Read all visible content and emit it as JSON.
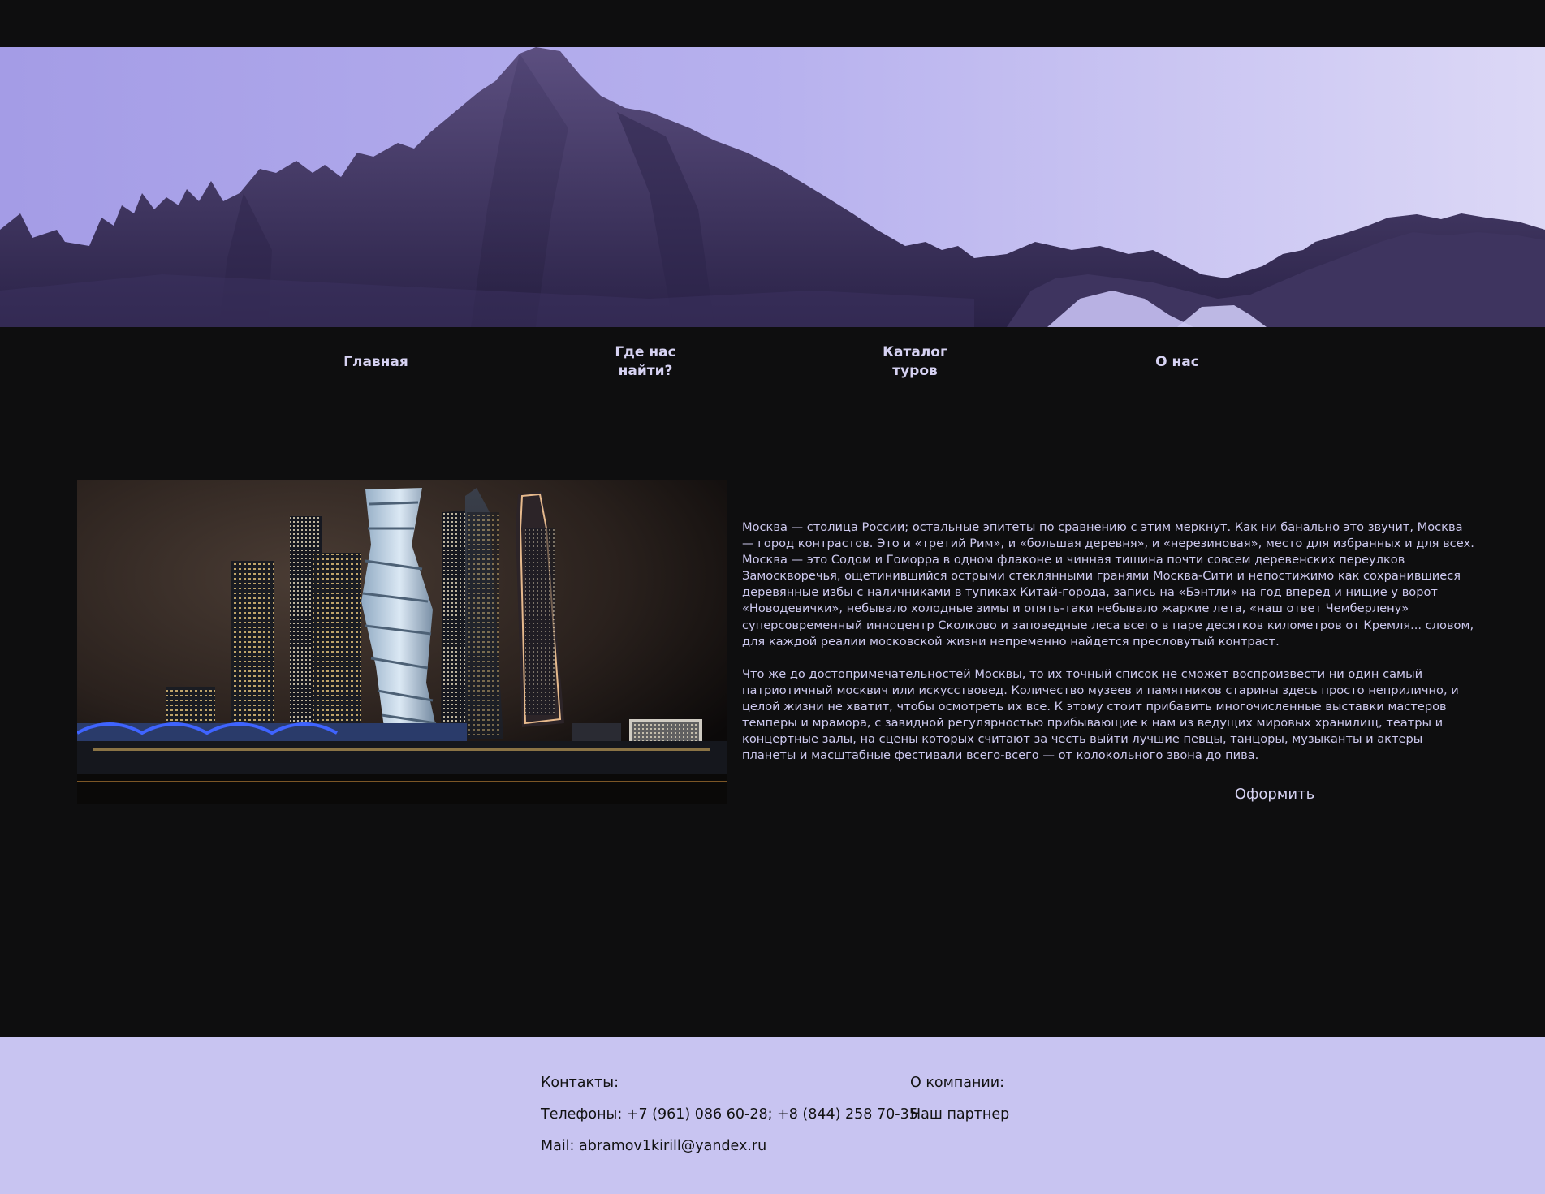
{
  "colors": {
    "page_background": "#0e0e0f",
    "nav_text": "#d6d2f2",
    "article_text": "#cdc9ef",
    "footer_background": "#c8c4f1",
    "footer_text": "#121212"
  },
  "nav": {
    "items": [
      {
        "label": "Главная"
      },
      {
        "label": "Где нас\nнайти?"
      },
      {
        "label": "Каталог\nтуров"
      },
      {
        "label": "О нас"
      }
    ]
  },
  "article": {
    "paragraphs": [
      "Москва — столица России; остальные эпитеты по сравнению с этим меркнут. Как ни банально это звучит, Москва — город контрастов. Это и «третий Рим», и «большая деревня», и «нерезиновая», место для избранных и для всех. Москва — это Содом и Гоморра в одном флаконе и чинная тишина почти совсем деревенских переулков Замоскворечья, ощетинившийся острыми стеклянными гранями Москва-Сити и непостижимо как сохранившиеся деревянные избы с наличниками в тупиках Китай-города, запись на «Бэнтли» на год вперед и нищие у ворот «Новодевички», небывало холодные зимы и опять-таки небывало жаркие лета, «наш ответ Чемберлену» суперсовременный инноцентр Сколково и заповедные леса всего в паре десятков километров от Кремля... словом, для каждой реалии московской жизни непременно найдется пресловутый контраст.",
      "Что же до достопримечательностей Москвы, то их точный список не сможет воспроизвести ни один самый патриотичный москвич или искусствовед. Количество музеев и памятников старины здесь просто неприлично, и целой жизни не хватит, чтобы осмотреть их все. К этому стоит прибавить многочисленные выставки мастеров темперы и мрамора, с завидной регулярностью прибывающие к нам из ведущих мировых хранилищ, театры и концертные залы, на сцены которых считают за честь выйти лучшие певцы, танцоры, музыканты и актеры планеты и масштабные фестивали всего-всего — от колокольного звона до пива."
    ]
  },
  "order_button": {
    "label": "Оформить"
  },
  "footer": {
    "contacts": {
      "heading": "Контакты:",
      "phones": "Телефоны: +7 (961) 086 60-28; +8 (844) 258 70-35",
      "mail": "Mail: abramov1kirill@yandex.ru"
    },
    "company": {
      "heading": "О компании:",
      "partner": "Наш партнер"
    }
  },
  "images": {
    "hero": "mountain-panorama",
    "content": "moscow-city-skyscrapers-night"
  }
}
